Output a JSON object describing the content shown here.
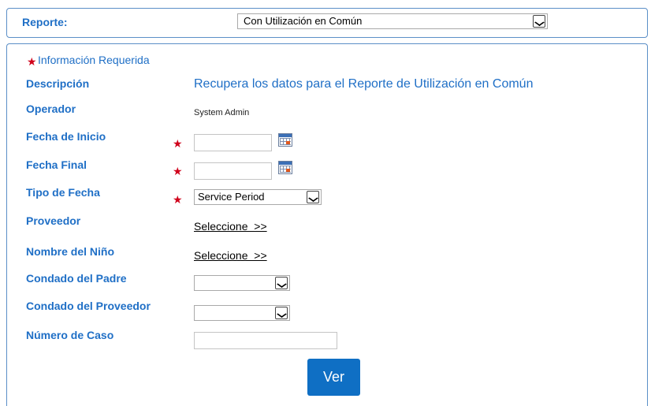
{
  "report": {
    "label": "Reporte:",
    "selected": "Con Utilización en Común"
  },
  "form": {
    "required_info": "Información Requerida",
    "description_label": "Descripción",
    "description_value": "Recupera los datos para el Reporte de Utilización en Común",
    "operator_label": "Operador",
    "operator_value": "System Admin",
    "start_date_label": "Fecha de Inicio",
    "start_date_value": "",
    "end_date_label": "Fecha Final",
    "end_date_value": "",
    "date_type_label": "Tipo de Fecha",
    "date_type_selected": "Service Period",
    "provider_label": "Proveedor",
    "provider_link": "Seleccione  >>",
    "child_name_label": "Nombre del Niño",
    "child_name_link": "Seleccione  >>",
    "parent_county_label": "Condado del Padre",
    "parent_county_selected": "",
    "provider_county_label": "Condado del Proveedor",
    "provider_county_selected": "",
    "case_number_label": "Número de Caso",
    "case_number_value": "",
    "submit_label": "Ver"
  },
  "colors": {
    "label": "#1f6fc6",
    "required_star": "#d0021b",
    "button": "#0f6fc4",
    "border": "#5b8fc7"
  }
}
